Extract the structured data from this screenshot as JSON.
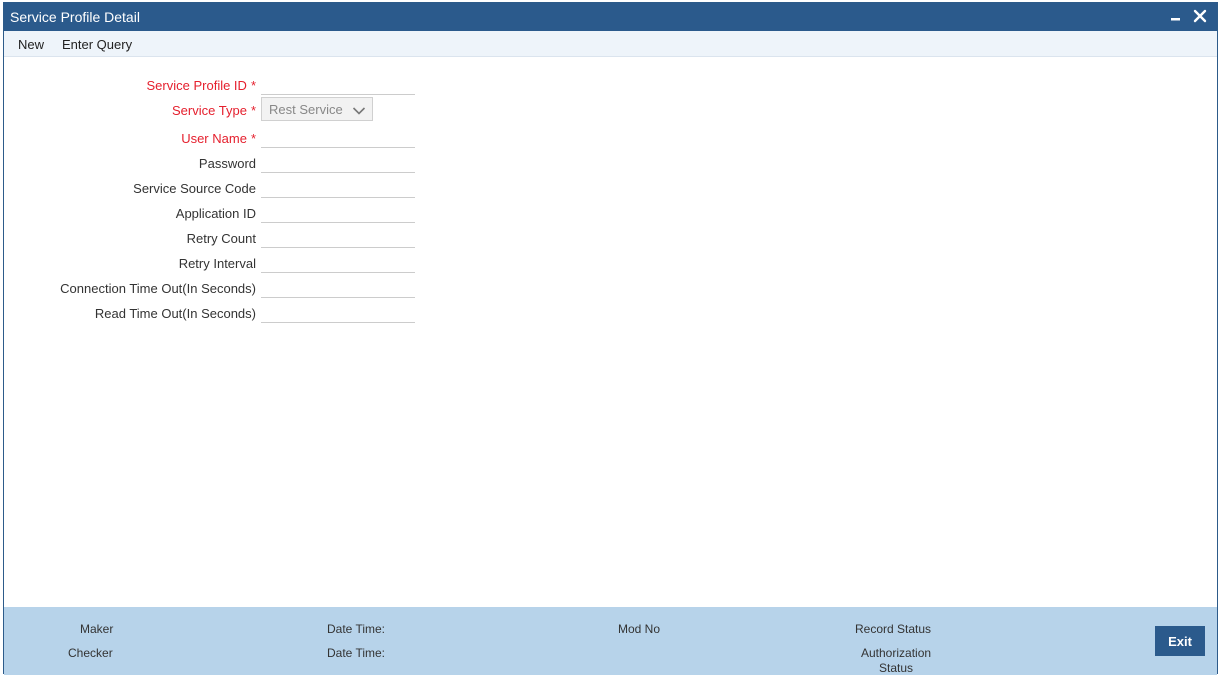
{
  "window": {
    "title": "Service Profile Detail"
  },
  "toolbar": {
    "new_label": "New",
    "enter_query_label": "Enter Query"
  },
  "form": {
    "service_profile_id": {
      "label": "Service Profile ID",
      "value": ""
    },
    "service_type": {
      "label": "Service Type",
      "selected": "Rest Service"
    },
    "user_name": {
      "label": "User Name",
      "value": ""
    },
    "password": {
      "label": "Password",
      "value": ""
    },
    "service_source_code": {
      "label": "Service Source Code",
      "value": ""
    },
    "application_id": {
      "label": "Application ID",
      "value": ""
    },
    "retry_count": {
      "label": "Retry Count",
      "value": ""
    },
    "retry_interval": {
      "label": "Retry Interval",
      "value": ""
    },
    "connection_timeout": {
      "label": "Connection Time Out(In Seconds)",
      "value": ""
    },
    "read_timeout": {
      "label": "Read Time Out(In Seconds)",
      "value": ""
    },
    "required_marker": "*"
  },
  "footer": {
    "maker_label": "Maker",
    "checker_label": "Checker",
    "date_time_label_1": "Date Time:",
    "date_time_label_2": "Date Time:",
    "mod_no_label": "Mod No",
    "record_status_label": "Record Status",
    "authorization_status_line1": "Authorization",
    "authorization_status_line2": "Status",
    "exit_label": "Exit"
  },
  "colors": {
    "titlebar": "#2b5a8c",
    "required": "#e5202e",
    "footer": "#b7d3ea",
    "exit_button": "#2b5a8c"
  },
  "icons": {
    "minimize": "minimize-icon",
    "close": "close-icon",
    "dropdown": "chevron-down-icon"
  }
}
